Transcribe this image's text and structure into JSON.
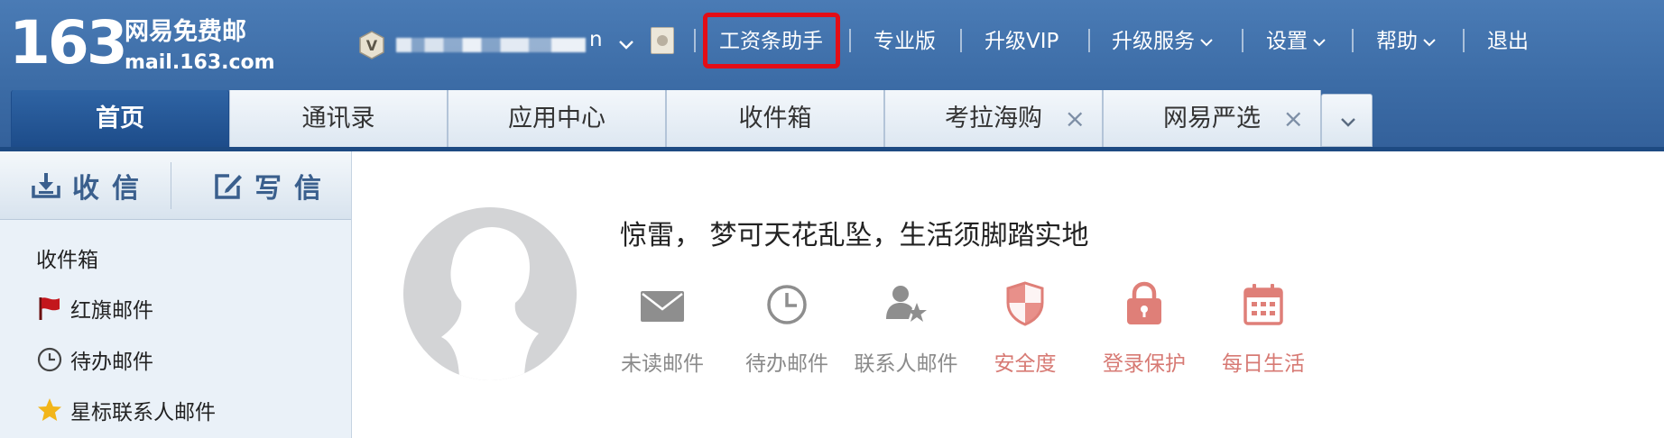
{
  "logo": {
    "number": "163",
    "name": "网易免费邮",
    "url": "mail.163.com"
  },
  "user": {
    "badge": "V",
    "name_tail": "n"
  },
  "topnav": {
    "salary_assistant": "工资条助手",
    "pro_edition": "专业版",
    "upgrade_vip": "升级VIP",
    "upgrade_service": "升级服务",
    "settings": "设置",
    "help": "帮助",
    "logout": "退出"
  },
  "tabs": [
    {
      "label": "首页",
      "active": true
    },
    {
      "label": "通讯录"
    },
    {
      "label": "应用中心"
    },
    {
      "label": "收件箱"
    },
    {
      "label": "考拉海购",
      "closable": true
    },
    {
      "label": "网易严选",
      "closable": true
    }
  ],
  "tab_close_glyph": "×",
  "sidebar": {
    "receive": "收信",
    "compose": "写信",
    "folders": [
      {
        "label": "收件箱",
        "icon": "none"
      },
      {
        "label": "红旗邮件",
        "icon": "red-flag-icon"
      },
      {
        "label": "待办邮件",
        "icon": "clock-icon"
      },
      {
        "label": "星标联系人邮件",
        "icon": "star-icon"
      }
    ]
  },
  "main": {
    "motto": "惊雷， 梦可天花乱坠，生活须脚踏实地",
    "quick": [
      {
        "label": "未读邮件",
        "icon": "envelope-icon"
      },
      {
        "label": "待办邮件",
        "icon": "clock-icon"
      },
      {
        "label": "联系人邮件",
        "icon": "contact-star-icon"
      },
      {
        "label": "安全度",
        "icon": "shield-icon"
      },
      {
        "label": "登录保护",
        "icon": "lock-icon"
      },
      {
        "label": "每日生活",
        "icon": "calendar-icon"
      }
    ]
  },
  "colors": {
    "header_blue": "#3c6ca6",
    "highlight_red": "#e30d16",
    "gray_icon": "#8e8e8e",
    "warn_icon": "#df7f78"
  }
}
